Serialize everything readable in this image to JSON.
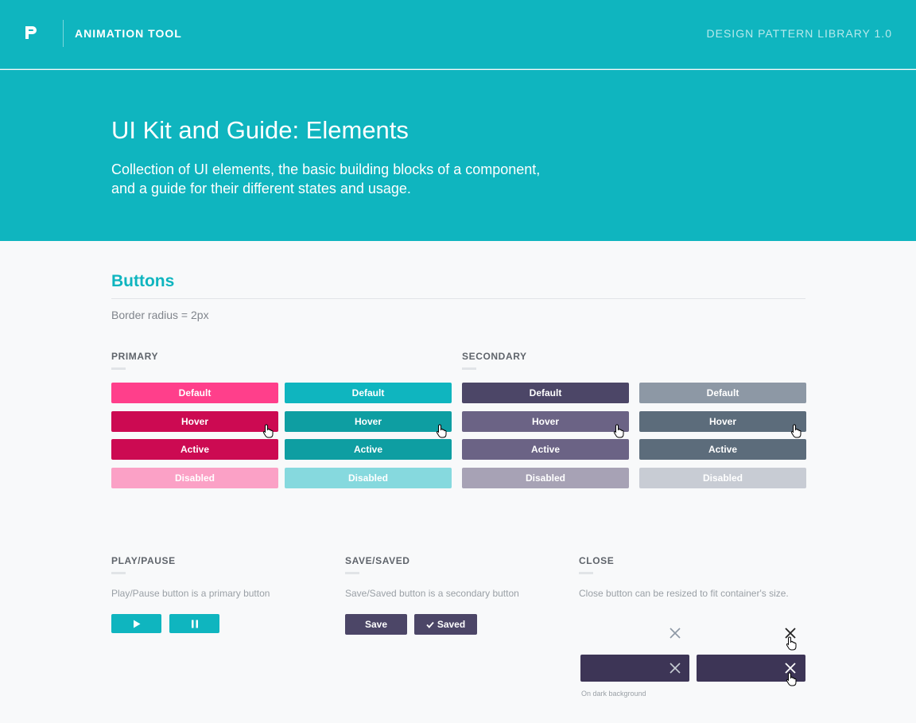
{
  "header": {
    "app_title": "ANIMATION TOOL",
    "library_title": "DESIGN PATTERN LIBRARY 1.0"
  },
  "hero": {
    "title": "UI Kit and Guide: Elements",
    "subtitle": "Collection of UI elements, the basic building blocks of a component, and a guide for their different states and usage."
  },
  "buttons": {
    "title": "Buttons",
    "note": "Border radius = 2px",
    "primary_label": "PRIMARY",
    "secondary_label": "SECONDARY",
    "states": [
      "Default",
      "Hover",
      "Active",
      "Disabled"
    ]
  },
  "play_pause": {
    "label": "PLAY/PAUSE",
    "description": "Play/Pause button is a primary button"
  },
  "save_saved": {
    "label": "SAVE/SAVED",
    "description": "Save/Saved button is a secondary button",
    "save": "Save",
    "saved": "Saved"
  },
  "close": {
    "label": "CLOSE",
    "description": "Close button can be resized to fit container's size.",
    "dark_note": "On dark background"
  },
  "colors": {
    "teal": "#0fb5bf",
    "pink_default": "#ff3f8b",
    "pink_hover": "#cc0a52",
    "pink_disabled": "#fba1c6",
    "teal_hover": "#0e9ea2",
    "teal_disabled": "#86d9de",
    "purple_default": "#4c4667",
    "purple_hover": "#6b6385",
    "purple_disabled": "#a7a2b5",
    "gray_default": "#8d98a5",
    "gray_hover": "#5c6c7b",
    "gray_disabled": "#c8ccd4"
  }
}
